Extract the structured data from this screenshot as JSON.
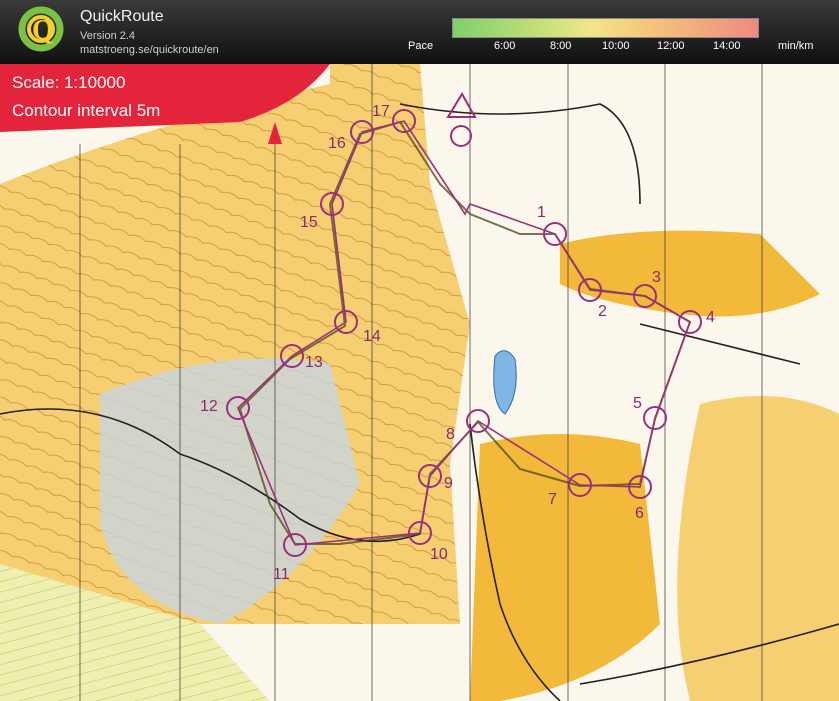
{
  "header": {
    "app_name": "QuickRoute",
    "version": "Version 2.4",
    "url": "matstroeng.se/quickroute/en",
    "pace_label": "Pace",
    "pace_ticks": [
      "6:00",
      "8:00",
      "10:00",
      "12:00",
      "14:00"
    ],
    "pace_unit": "min/km",
    "logo_letter": "Q"
  },
  "map": {
    "scale_text": "Scale: 1:10000",
    "contour_text": "Contour interval 5m",
    "controls": [
      {
        "label": "1"
      },
      {
        "label": "2"
      },
      {
        "label": "3"
      },
      {
        "label": "4"
      },
      {
        "label": "5"
      },
      {
        "label": "6"
      },
      {
        "label": "7"
      },
      {
        "label": "8"
      },
      {
        "label": "9"
      },
      {
        "label": "10"
      },
      {
        "label": "11"
      },
      {
        "label": "12"
      },
      {
        "label": "13"
      },
      {
        "label": "14"
      },
      {
        "label": "15"
      },
      {
        "label": "16"
      },
      {
        "label": "17"
      }
    ],
    "colors": {
      "course": "#9b2f7d",
      "route": "#5a5a2a",
      "forest_open": "#f2b93b",
      "water": "#7fb6e6",
      "marsh": "#b9c9d6"
    }
  }
}
